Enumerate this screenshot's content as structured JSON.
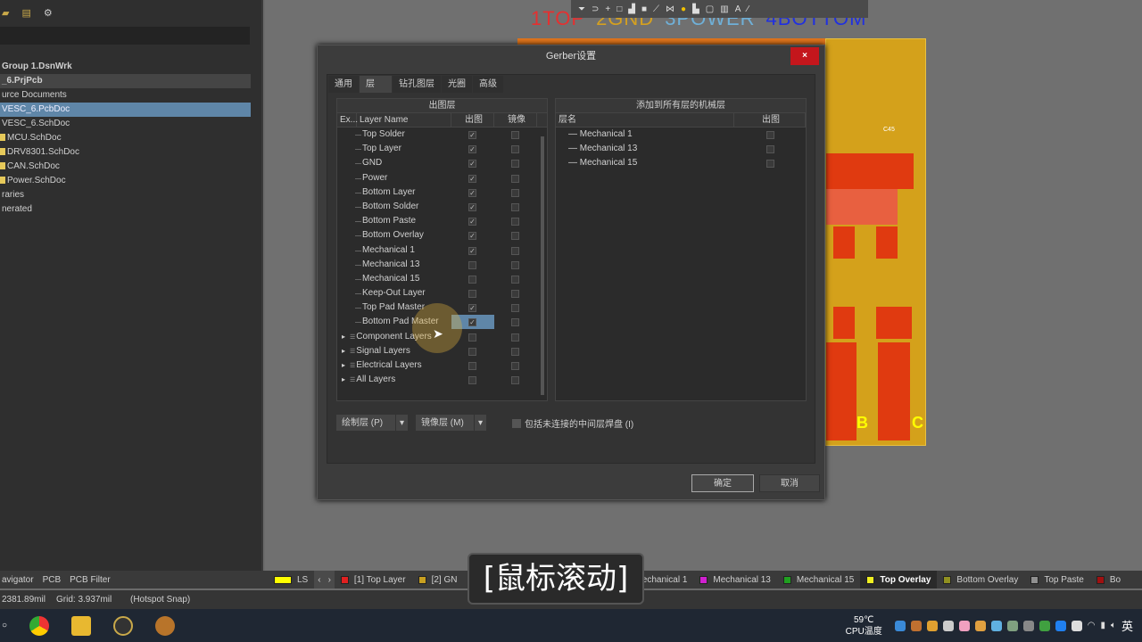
{
  "left_panel": {
    "tree": [
      {
        "label": "Group 1.DsnWrk",
        "style": "b"
      },
      {
        "label": "_6.PrjPcb",
        "style": "b proj"
      },
      {
        "label": "urce Documents",
        "style": ""
      },
      {
        "label": "VESC_6.PcbDoc",
        "style": "sel"
      },
      {
        "label": "VESC_6.SchDoc",
        "style": ""
      },
      {
        "label": "MCU.SchDoc",
        "style": "f"
      },
      {
        "label": "DRV8301.SchDoc",
        "style": "f"
      },
      {
        "label": "CAN.SchDoc",
        "style": "f"
      },
      {
        "label": "Power.SchDoc",
        "style": "f"
      },
      {
        "label": "raries",
        "style": ""
      },
      {
        "label": "nerated",
        "style": ""
      }
    ]
  },
  "pcb": {
    "layer_labels": [
      {
        "text": "1TOP",
        "color": "#e53030"
      },
      {
        "text": "2GND",
        "color": "#d4a020"
      },
      {
        "text": "3POWER",
        "color": "#6fb0d8"
      },
      {
        "text": "4BOTTOM",
        "color": "#2030e0"
      }
    ],
    "silk": [
      "C45",
      "B",
      "C"
    ]
  },
  "dialog": {
    "title": "Gerber设置",
    "close": "×",
    "tabs": [
      "通用",
      "层",
      "钻孔图层",
      "光圈",
      "高级"
    ],
    "active_tab": 1,
    "left_panel": {
      "header": "出图层",
      "columns": [
        "Ex...",
        "Layer Name",
        "出图",
        "镜像"
      ],
      "rows": [
        {
          "name": "Top Solder",
          "plot": true,
          "mirror": false
        },
        {
          "name": "Top Layer",
          "plot": true,
          "mirror": false
        },
        {
          "name": "GND",
          "plot": true,
          "mirror": false
        },
        {
          "name": "Power",
          "plot": true,
          "mirror": false
        },
        {
          "name": "Bottom Layer",
          "plot": true,
          "mirror": false
        },
        {
          "name": "Bottom Solder",
          "plot": true,
          "mirror": false
        },
        {
          "name": "Bottom Paste",
          "plot": true,
          "mirror": false
        },
        {
          "name": "Bottom Overlay",
          "plot": true,
          "mirror": false
        },
        {
          "name": "Mechanical 1",
          "plot": true,
          "mirror": false
        },
        {
          "name": "Mechanical 13",
          "plot": false,
          "mirror": false
        },
        {
          "name": "Mechanical 15",
          "plot": false,
          "mirror": false
        },
        {
          "name": "Keep-Out Layer",
          "plot": false,
          "mirror": false
        },
        {
          "name": "Top Pad Master",
          "plot": true,
          "mirror": false
        },
        {
          "name": "Bottom Pad Master",
          "plot": true,
          "mirror": false,
          "highlight": true
        },
        {
          "name": "Component Layers",
          "plot": false,
          "mirror": false,
          "group": true
        },
        {
          "name": "Signal Layers",
          "plot": false,
          "mirror": false,
          "group": true
        },
        {
          "name": "Electrical Layers",
          "plot": false,
          "mirror": false,
          "group": true
        },
        {
          "name": "All Layers",
          "plot": false,
          "mirror": false,
          "group": true
        }
      ]
    },
    "right_panel": {
      "header": "添加到所有层的机械层",
      "columns": [
        "层名",
        "出图"
      ],
      "rows": [
        {
          "name": "Mechanical 1",
          "plot": false
        },
        {
          "name": "Mechanical 13",
          "plot": false
        },
        {
          "name": "Mechanical 15",
          "plot": false
        }
      ]
    },
    "plot_layers_btn": "绘制层 (P)",
    "mirror_layers_btn": "镜像层 (M)",
    "include_unconnected": {
      "label": "包括未连接的中间层焊盘 (I)",
      "checked": false
    },
    "ok": "确定",
    "cancel": "取消"
  },
  "caption": "[鼠标滚动]",
  "layer_bar": {
    "ls": "LS",
    "tabs": [
      {
        "label": "[1] Top Layer",
        "color": "#e02020"
      },
      {
        "label": "[2] GN",
        "color": "#c8a020"
      },
      {
        "label": "Mechanical 1",
        "color": "#d020d0"
      },
      {
        "label": "Mechanical 13",
        "color": "#d020d0"
      },
      {
        "label": "Mechanical 15",
        "color": "#20a020"
      },
      {
        "label": "Top Overlay",
        "color": "#f0f020",
        "active": true
      },
      {
        "label": "Bottom Overlay",
        "color": "#909020"
      },
      {
        "label": "Top Paste",
        "color": "#909090"
      },
      {
        "label": "Bo",
        "color": "#a01010"
      }
    ]
  },
  "panel_tabs": [
    "avigator",
    "PCB",
    "PCB Filter"
  ],
  "status": {
    "coords": "2381.89mil",
    "grid": "Grid: 3.937mil",
    "snap": "(Hotspot Snap)"
  },
  "taskbar": {
    "temp": "59℃",
    "temp_label": "CPU温度",
    "ime": "英"
  }
}
